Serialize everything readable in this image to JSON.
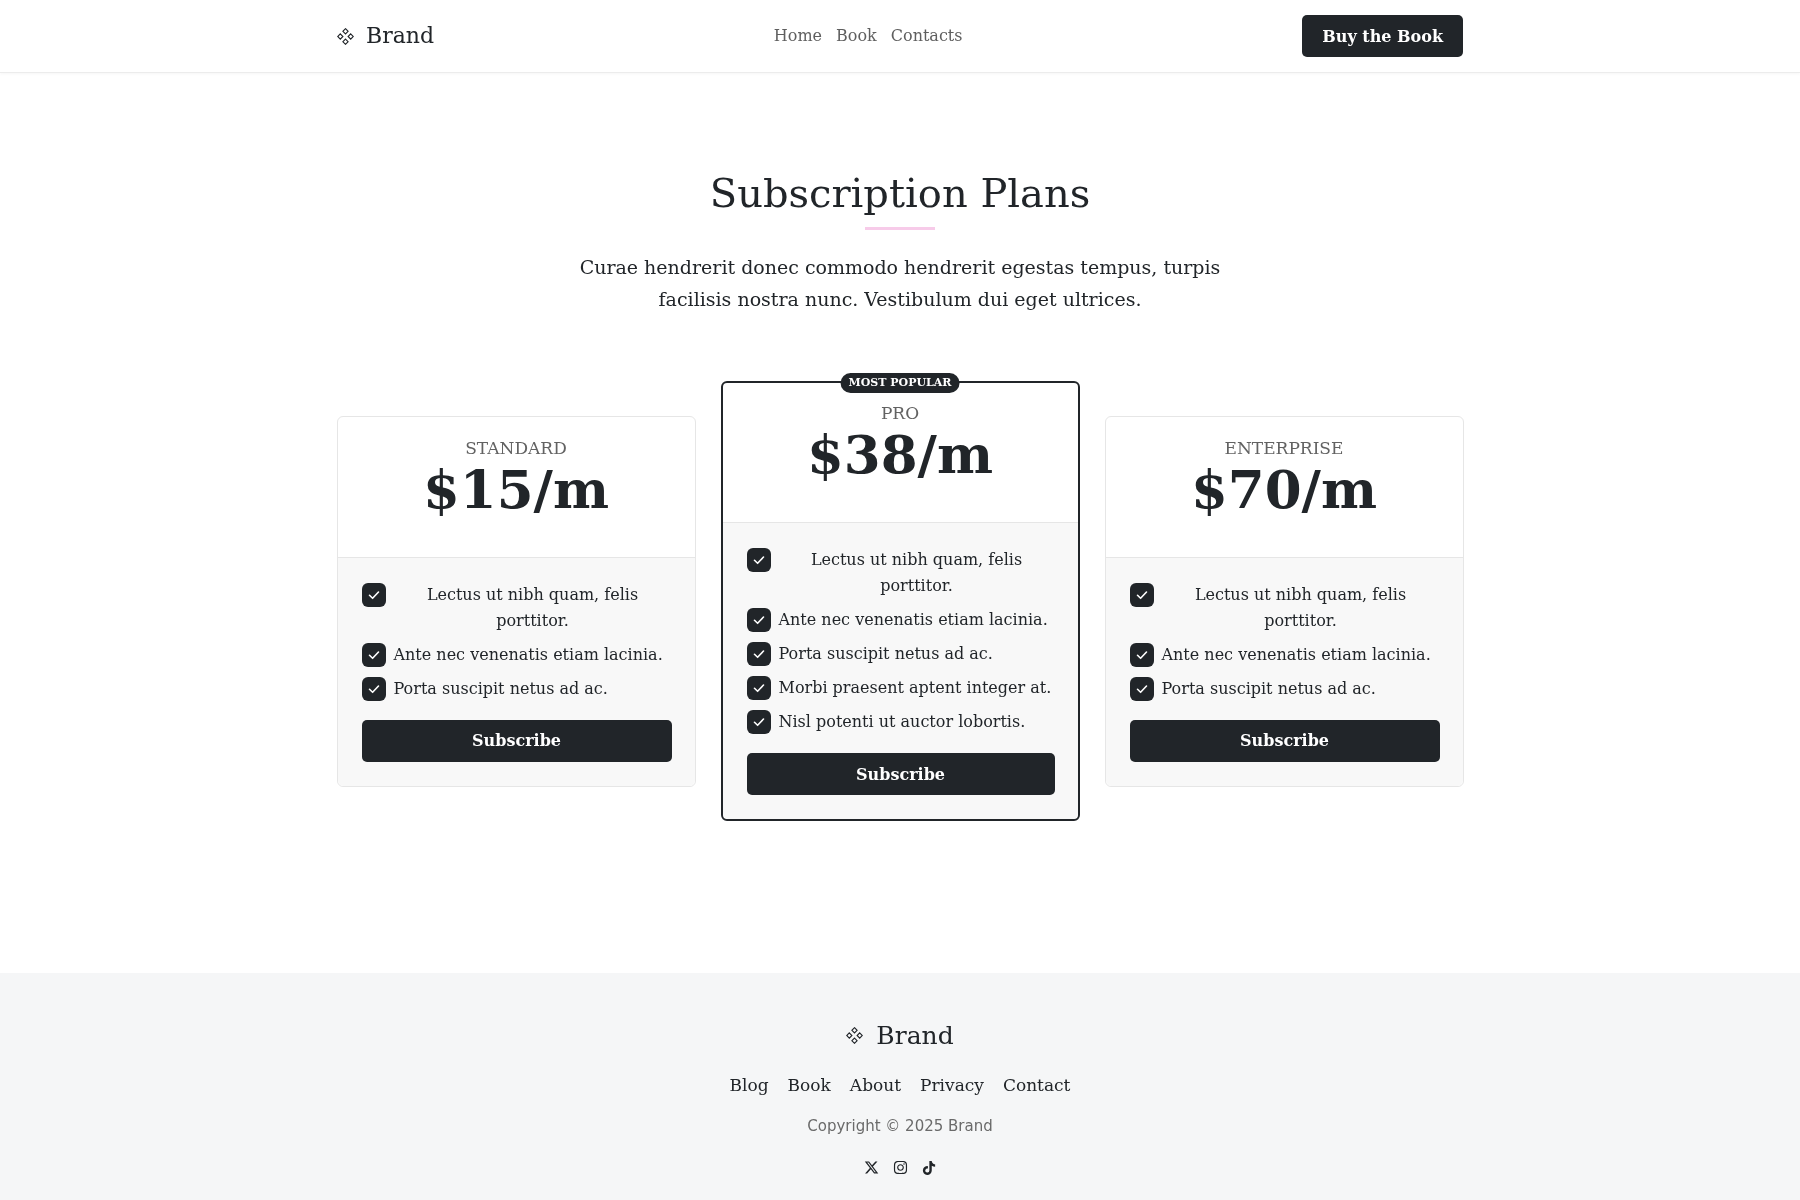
{
  "header": {
    "brand": "Brand",
    "nav": [
      "Home",
      "Book",
      "Contacts"
    ],
    "cta": "Buy the Book"
  },
  "hero": {
    "title": "Subscription Plans",
    "subtitle": "Curae hendrerit donec commodo hendrerit egestas tempus, turpis facilisis nostra nunc. Vestibulum dui eget ultrices."
  },
  "plans": [
    {
      "name": "STANDARD",
      "price": "$15/m",
      "featured": false,
      "features": [
        "Lectus ut nibh quam, felis porttitor.",
        "Ante nec venenatis etiam lacinia.",
        "Porta suscipit netus ad ac."
      ],
      "button": "Subscribe"
    },
    {
      "name": "PRO",
      "price": "$38/m",
      "featured": true,
      "badge": "MOST POPULAR",
      "features": [
        "Lectus ut nibh quam, felis porttitor.",
        "Ante nec venenatis etiam lacinia.",
        "Porta suscipit netus ad ac.",
        "Morbi praesent aptent integer at.",
        "Nisl potenti ut auctor lobortis."
      ],
      "button": "Subscribe"
    },
    {
      "name": "ENTERPRISE",
      "price": "$70/m",
      "featured": false,
      "features": [
        "Lectus ut nibh quam, felis porttitor.",
        "Ante nec venenatis etiam lacinia.",
        "Porta suscipit netus ad ac."
      ],
      "button": "Subscribe"
    }
  ],
  "footer": {
    "brand": "Brand",
    "links": [
      "Blog",
      "Book",
      "About",
      "Privacy",
      "Contact"
    ],
    "copyright": "Copyright © 2025 Brand"
  }
}
